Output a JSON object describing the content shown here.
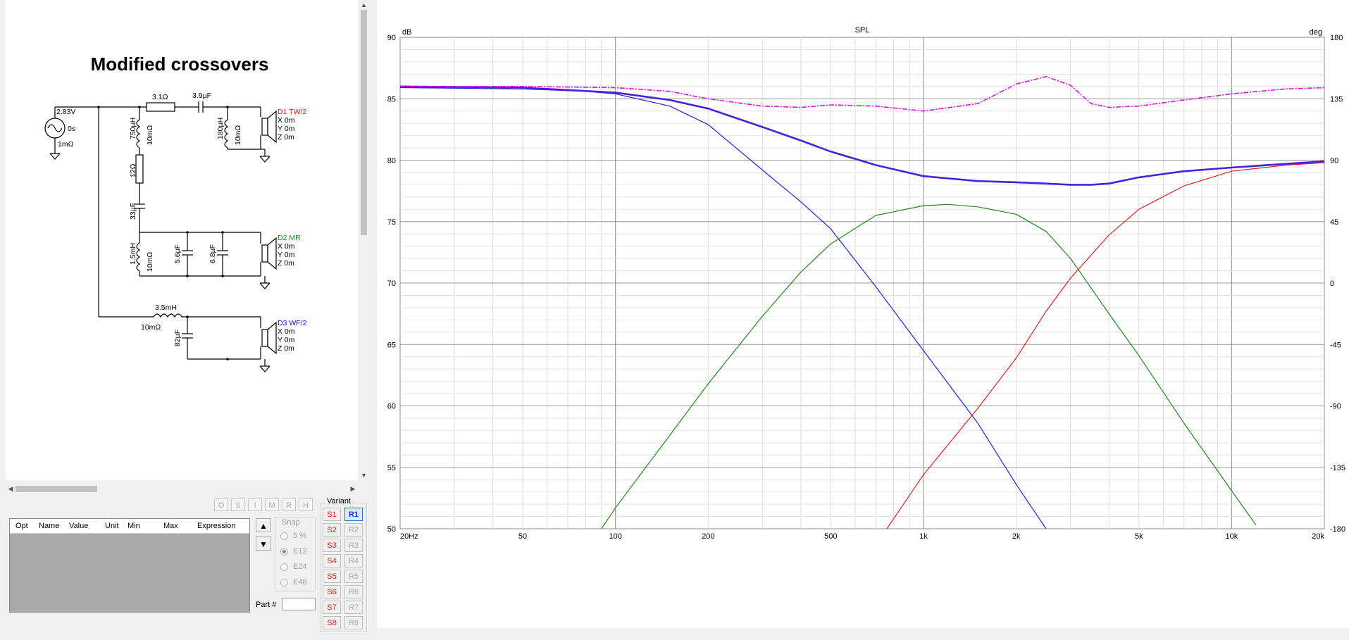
{
  "schematic": {
    "title": "Modified crossovers",
    "source": {
      "voltage": "2.83V",
      "delay": "0s",
      "resistance": "1mΩ"
    },
    "components": {
      "r1": "3.1Ω",
      "c1": "3.9µF",
      "l1": "750µH",
      "l1r": "10mΩ",
      "l2": "180µH",
      "l2r": "10mΩ",
      "r2": "12Ω",
      "c2": "33µF",
      "l3": "1.5mH",
      "l3r": "10mΩ",
      "c3": "5.6µF",
      "c4": "6.8µF",
      "l4": "3.5mH",
      "l4r": "10mΩ",
      "c5": "82µF"
    },
    "drivers": [
      {
        "name": "D1 TW/2",
        "x": "X 0m",
        "y": "Y 0m",
        "z": "Z 0m"
      },
      {
        "name": "D2 MR",
        "x": "X 0m",
        "y": "Y 0m",
        "z": "Z 0m"
      },
      {
        "name": "D3 WF/2",
        "x": "X 0m",
        "y": "Y 0m",
        "z": "Z 0m"
      }
    ]
  },
  "toolbar": {
    "buttons": [
      "O",
      "S",
      "I",
      "M",
      "R",
      "H"
    ]
  },
  "param_table": {
    "columns": [
      "Opt",
      "Name",
      "Value",
      "Unit",
      "Min",
      "Max",
      "Expression"
    ]
  },
  "snap": {
    "title": "Snap",
    "options": [
      "5 %",
      "E12",
      "E24",
      "E48"
    ],
    "selected": "E12"
  },
  "part": {
    "label": "Part #"
  },
  "variant": {
    "title": "Variant",
    "s_buttons": [
      "S1",
      "S2",
      "S3",
      "S4",
      "S5",
      "S6",
      "S7",
      "S8"
    ],
    "r_buttons": [
      "R1",
      "R2",
      "R3",
      "R4",
      "R5",
      "R6",
      "R7",
      "R8"
    ],
    "selected": "R1"
  },
  "chart_data": {
    "type": "line",
    "title": "SPL",
    "ylabel": "dB",
    "y2label": "deg",
    "xscale": "log",
    "xlim": [
      20,
      20000
    ],
    "ylim": [
      50,
      90
    ],
    "y2lim": [
      -180,
      180
    ],
    "x_ticks": [
      "20Hz",
      "50",
      "100",
      "200",
      "500",
      "1k",
      "2k",
      "5k",
      "10k",
      "20k"
    ],
    "y_ticks": [
      90,
      85,
      80,
      75,
      70,
      65,
      60,
      55,
      50
    ],
    "y2_ticks": [
      180,
      135,
      90,
      45,
      0,
      -45,
      -90,
      -135,
      -180
    ],
    "grid": true,
    "colors": {
      "woofer": "#2020e0",
      "mid": "#1f8a1f",
      "tweeter": "#e02020",
      "sum": "#4a20d8",
      "dashed": "#e010e0"
    },
    "series": [
      {
        "color": "#2020e0",
        "x": [
          20,
          50,
          80,
          100,
          150,
          200,
          300,
          400,
          500,
          700,
          1000,
          1500,
          2000,
          2500
        ],
        "y": [
          85.9,
          85.8,
          85.6,
          85.4,
          84.4,
          82.9,
          79.2,
          76.6,
          74.4,
          69.7,
          64.5,
          58.6,
          53.6,
          50.0
        ]
      },
      {
        "color": "#1f8a1f",
        "x": [
          90,
          100,
          150,
          200,
          300,
          400,
          500,
          700,
          1000,
          1200,
          1500,
          2000,
          2500,
          3000,
          4000,
          5000,
          7000,
          10000,
          12000
        ],
        "y": [
          50.0,
          51.7,
          57.6,
          61.8,
          67.3,
          70.9,
          73.2,
          75.5,
          76.3,
          76.4,
          76.2,
          75.6,
          74.2,
          72.0,
          67.5,
          64.1,
          58.6,
          53.1,
          50.3
        ]
      },
      {
        "color": "#e02020",
        "x": [
          760,
          1000,
          1500,
          2000,
          2500,
          3000,
          4000,
          5000,
          7000,
          10000,
          15000,
          20000
        ],
        "y": [
          50.0,
          54.4,
          59.8,
          63.9,
          67.7,
          70.4,
          73.9,
          76.0,
          77.9,
          79.1,
          79.6,
          79.8
        ]
      },
      {
        "color": "#4a20d8",
        "x": [
          20,
          50,
          100,
          150,
          200,
          300,
          400,
          500,
          700,
          1000,
          1500,
          2000,
          2500,
          3000,
          3500,
          4000,
          5000,
          7000,
          10000,
          15000,
          20000
        ],
        "y": [
          86.0,
          85.9,
          85.5,
          84.9,
          84.2,
          82.7,
          81.6,
          80.7,
          79.6,
          78.7,
          78.3,
          78.2,
          78.1,
          78.0,
          78.0,
          78.1,
          78.6,
          79.1,
          79.4,
          79.7,
          79.9
        ]
      },
      {
        "color": "#e010e0",
        "dashed": true,
        "x": [
          20,
          50,
          100,
          150,
          200,
          300,
          400,
          500,
          700,
          1000,
          1500,
          2000,
          2500,
          3000,
          3500,
          4000,
          5000,
          7000,
          10000,
          15000,
          20000
        ],
        "y": [
          86.0,
          86.0,
          85.9,
          85.6,
          85.0,
          84.4,
          84.3,
          84.5,
          84.4,
          84.0,
          84.6,
          86.2,
          86.8,
          86.1,
          84.6,
          84.3,
          84.4,
          84.9,
          85.4,
          85.8,
          85.9
        ]
      }
    ]
  }
}
